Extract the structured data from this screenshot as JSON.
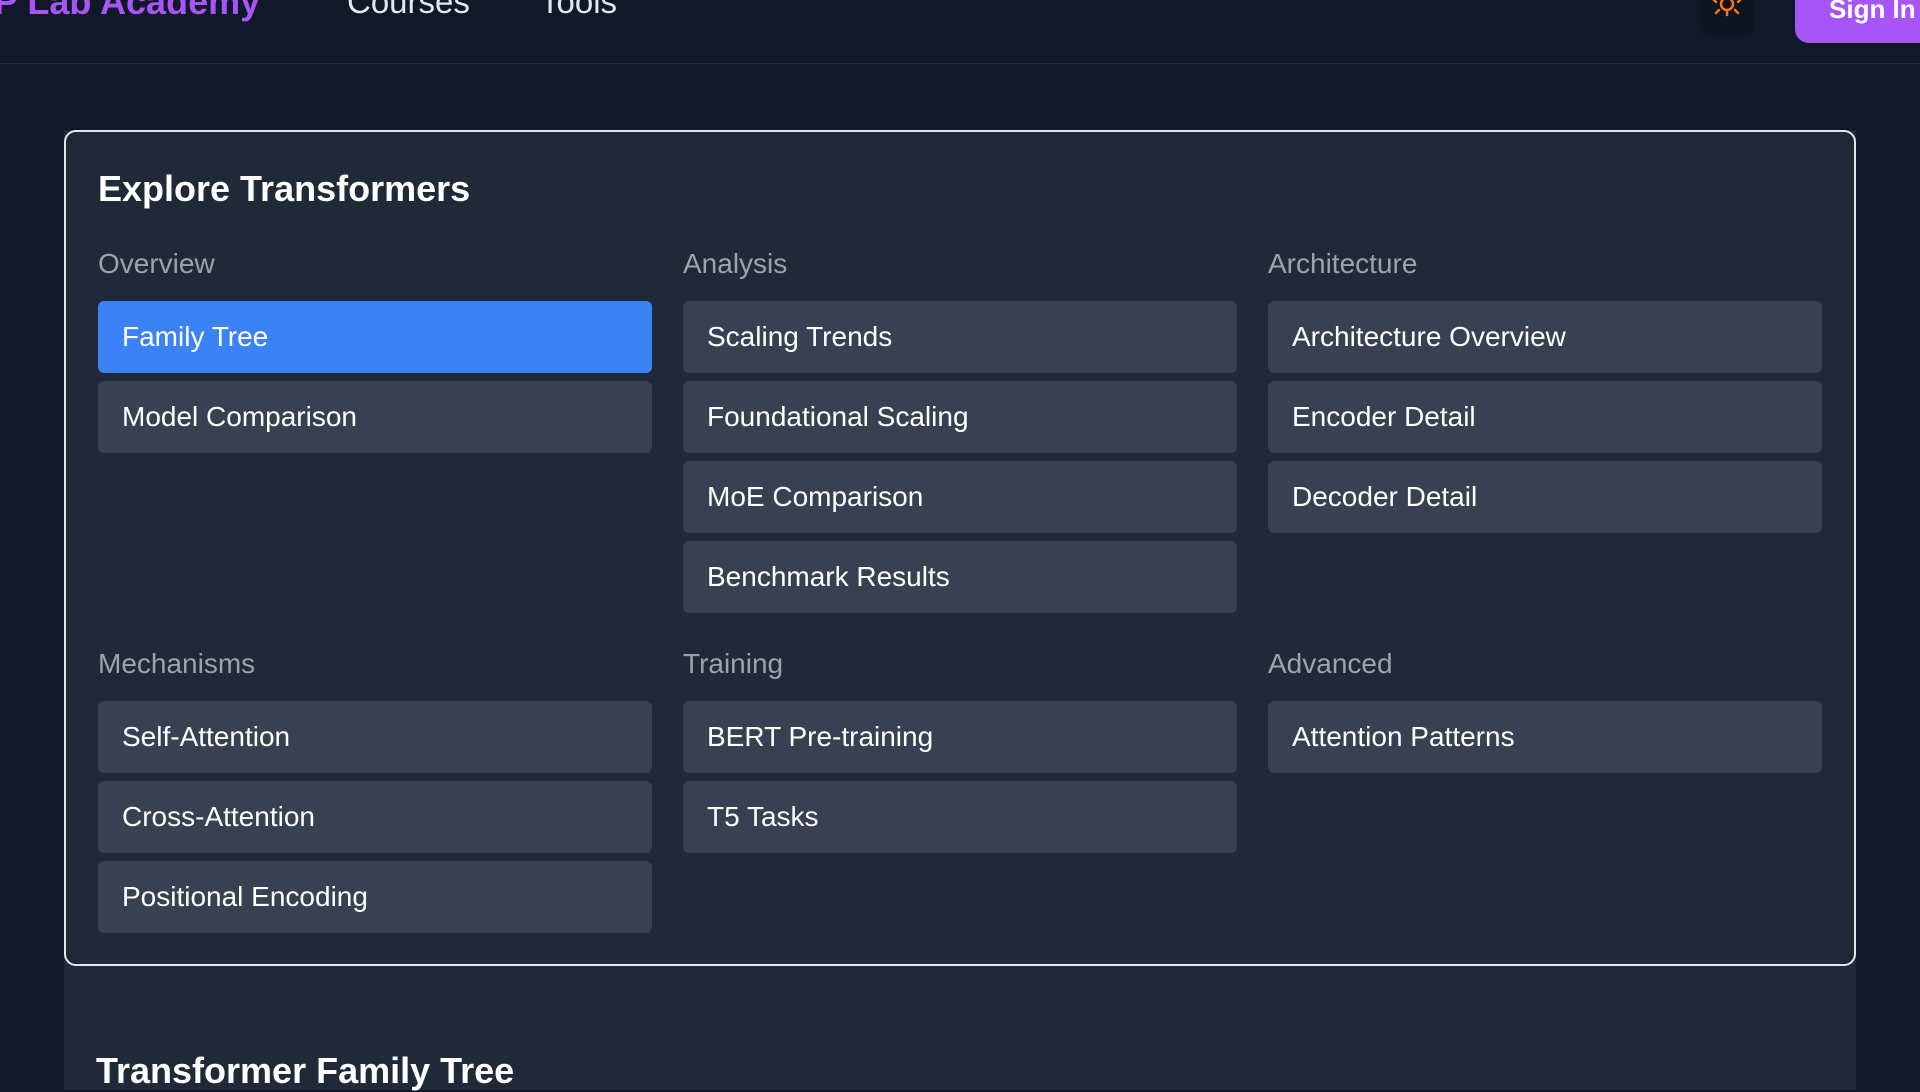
{
  "header": {
    "brand": "P Lab Academy",
    "nav": [
      "Courses",
      "Tools"
    ],
    "theme_icon": "sun-icon",
    "sign_in_label": "Sign In"
  },
  "explore": {
    "title": "Explore Transformers",
    "groups": [
      {
        "label": "Overview",
        "items": [
          "Family Tree",
          "Model Comparison"
        ]
      },
      {
        "label": "Analysis",
        "items": [
          "Scaling Trends",
          "Foundational Scaling",
          "MoE Comparison",
          "Benchmark Results"
        ]
      },
      {
        "label": "Architecture",
        "items": [
          "Architecture Overview",
          "Encoder Detail",
          "Decoder Detail"
        ]
      },
      {
        "label": "Mechanisms",
        "items": [
          "Self-Attention",
          "Cross-Attention",
          "Positional Encoding"
        ]
      },
      {
        "label": "Training",
        "items": [
          "BERT Pre-training",
          "T5 Tasks"
        ]
      },
      {
        "label": "Advanced",
        "items": [
          "Attention Patterns"
        ]
      }
    ],
    "active_item": "Family Tree"
  },
  "next_section": {
    "title": "Transformer Family Tree"
  },
  "colors": {
    "accent_purple": "#a855f7",
    "active_blue": "#3b82f6",
    "item_bg": "#374151",
    "panel_bg": "#1f2937",
    "page_bg": "#111827"
  }
}
